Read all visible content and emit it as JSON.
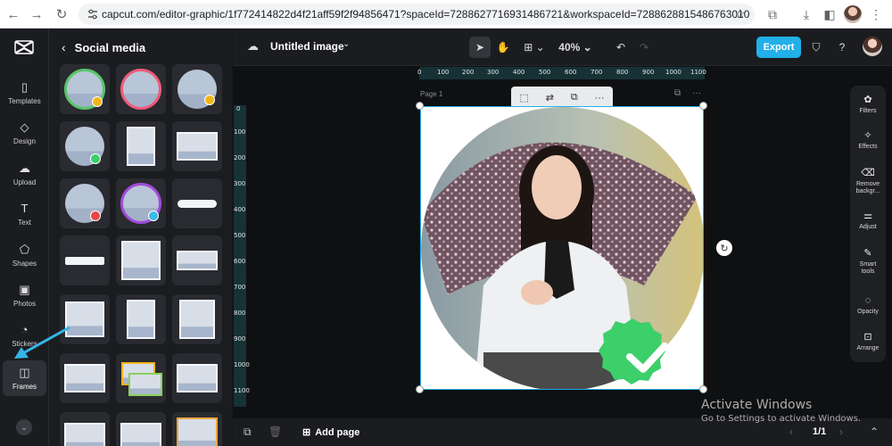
{
  "browser": {
    "url": "capcut.com/editor-graphic/1f772414822d4f21aff59f2f94856471?spaceId=7288627716931486721&workspaceId=7288628815486763010"
  },
  "rail": {
    "items": [
      {
        "label": "Templates",
        "icon": "templates-icon"
      },
      {
        "label": "Design",
        "icon": "design-icon"
      },
      {
        "label": "Upload",
        "icon": "upload-icon"
      },
      {
        "label": "Text",
        "icon": "text-icon"
      },
      {
        "label": "Shapes",
        "icon": "shapes-icon"
      },
      {
        "label": "Photos",
        "icon": "photos-icon"
      },
      {
        "label": "Stickers",
        "icon": "stickers-icon"
      },
      {
        "label": "Frames",
        "icon": "frames-icon"
      }
    ],
    "active": "Frames"
  },
  "panel": {
    "title": "Social media"
  },
  "toolbar": {
    "doc_title": "Untitled image",
    "zoom": "40%",
    "export_label": "Export"
  },
  "canvas": {
    "page_label": "Page 1",
    "ruler_h": [
      "0",
      "100",
      "200",
      "300",
      "400",
      "500",
      "600",
      "700",
      "800",
      "900",
      "1000",
      "1100"
    ],
    "ruler_v": [
      "0",
      "100",
      "200",
      "300",
      "400",
      "500",
      "600",
      "700",
      "800",
      "900",
      "1000",
      "1100"
    ]
  },
  "right_panel": {
    "items": [
      {
        "label": "Filters"
      },
      {
        "label": "Effects"
      },
      {
        "label": "Remove backgr..."
      },
      {
        "label": "Adjust"
      },
      {
        "label": "Smart tools"
      },
      {
        "label": "Opacity"
      },
      {
        "label": "Arrange"
      }
    ]
  },
  "bottom": {
    "add_page_label": "Add page",
    "page_counter": "1/1"
  },
  "watermark": {
    "title": "Activate Windows",
    "subtitle": "Go to Settings to activate Windows."
  },
  "colors": {
    "accent": "#22b0e8",
    "check_green": "#3ccf6a"
  }
}
